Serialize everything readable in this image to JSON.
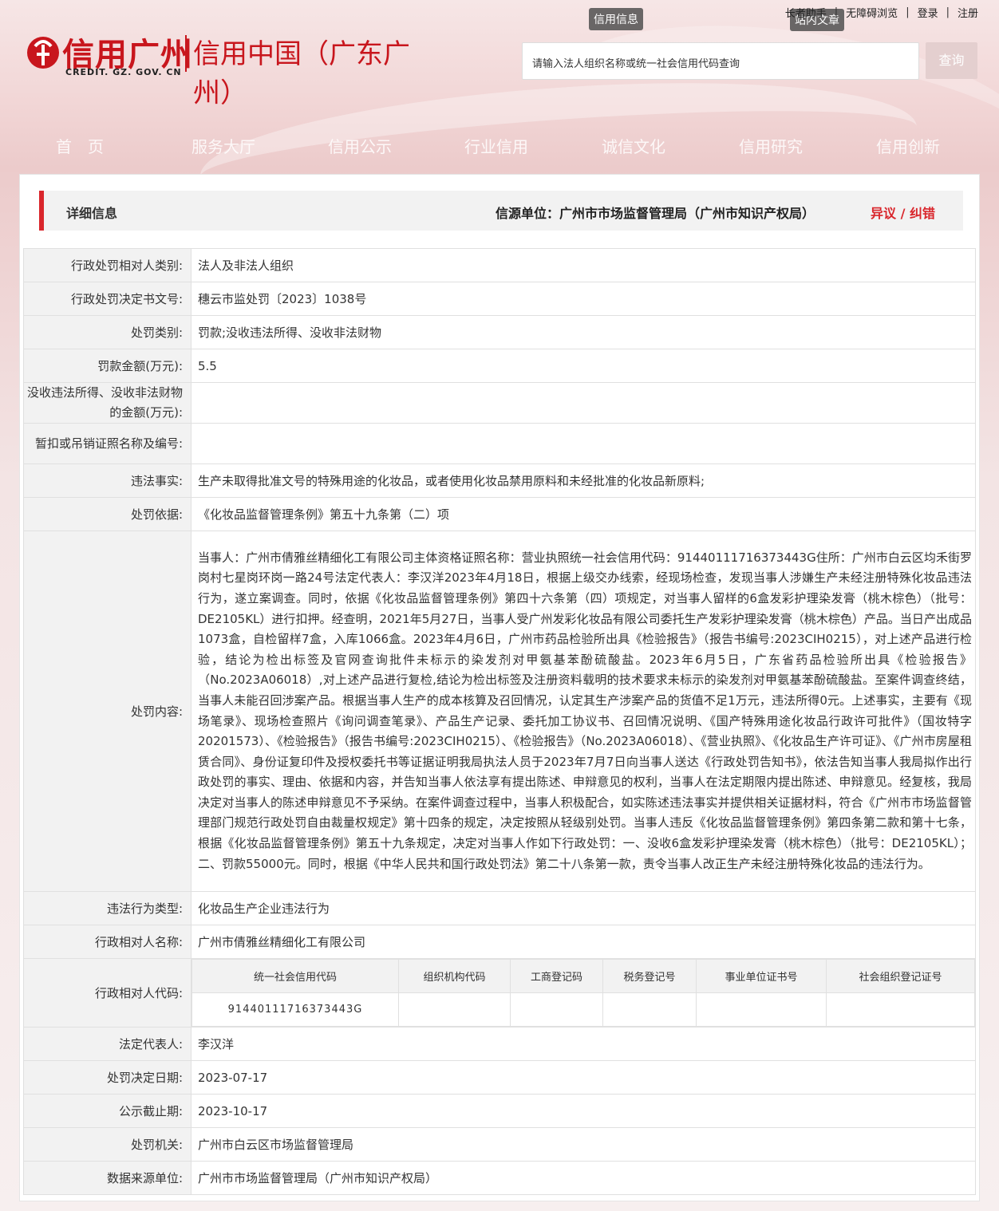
{
  "header": {
    "logo_cn": "信用广州",
    "logo_en": "CREDIT. GZ. GOV. CN",
    "site_title": "信用中国（广东广州）",
    "tag_credit": "信用信息",
    "tag_site": "站内文章",
    "toplinks": [
      "长者助手",
      "无障碍浏览",
      "登录",
      "注册"
    ],
    "search_placeholder": "请输入法人组织名称或统一社会信用代码查询",
    "search_button": "查询"
  },
  "nav": [
    "首　页",
    "服务大厅",
    "信用公示",
    "行业信用",
    "诚信文化",
    "信用研究",
    "信用创新"
  ],
  "titlebar": {
    "title": "详细信息",
    "source": "信源单位：广州市市场监督管理局（广州市知识产权局）",
    "objection": "异议 / 纠错"
  },
  "rows": [
    {
      "label": "行政处罚相对人类别:",
      "value": "法人及非法人组织"
    },
    {
      "label": "行政处罚决定书文号:",
      "value": "穗云市监处罚〔2023〕1038号"
    },
    {
      "label": "处罚类别:",
      "value": "罚款;没收违法所得、没收非法财物"
    },
    {
      "label": "罚款金额(万元):",
      "value": "5.5"
    },
    {
      "label": "没收违法所得、没收非法财物的金额(万元):",
      "value": ""
    },
    {
      "label": "暂扣或吊销证照名称及编号:",
      "value": ""
    },
    {
      "label": "违法事实:",
      "value": "生产未取得批准文号的特殊用途的化妆品，或者使用化妆品禁用原料和未经批准的化妆品新原料;"
    },
    {
      "label": "处罚依据:",
      "value": "《化妆品监督管理条例》第五十九条第（二）项"
    },
    {
      "label": "处罚内容:",
      "value": "当事人：广州市倩雅丝精细化工有限公司主体资格证照名称：营业执照统一社会信用代码：91440111716373443G住所：广州市白云区均禾街罗岗村七星岗环岗一路24号法定代表人：李汉洋2023年4月18日，根据上级交办线索，经现场检查，发现当事人涉嫌生产未经注册特殊化妆品违法行为，遂立案调查。同时，依据《化妆品监督管理条例》第四十六条第（四）项规定，对当事人留样的6盒发彩护理染发膏（桃木棕色）（批号：DE2105KL）进行扣押。经查明，2021年5月27日，当事人受广州发彩化妆品有限公司委托生产发彩护理染发膏（桃木棕色）产品。当日产出成品1073盒，自检留样7盒，入库1066盒。2023年4月6日，广州市药品检验所出具《检验报告》（报告书编号:2023CIH0215），对上述产品进行检验，结论为检出标签及官网查询批件未标示的染发剂对甲氨基苯酚硫酸盐。2023年6月5日，广东省药品检验所出具《检验报告》（No.2023A06018）,对上述产品进行复检,结论为检出标签及注册资料载明的技术要求未标示的染发剂对甲氨基苯酚硫酸盐。至案件调查终结，当事人未能召回涉案产品。根据当事人生产的成本核算及召回情况，认定其生产涉案产品的货值不足1万元，违法所得0元。上述事实，主要有《现场笔录》、现场检查照片《询问调查笔录》、产品生产记录、委托加工协议书、召回情况说明、《国产特殊用途化妆品行政许可批件》（国妆特字20201573）、《检验报告》（报告书编号:2023CIH0215）、《检验报告》（No.2023A06018）、《营业执照》、《化妆品生产许可证》、《广州市房屋租赁合同》、身份证复印件及授权委托书等证据证明我局执法人员于2023年7月7日向当事人送达《行政处罚告知书》，依法告知当事人我局拟作出行政处罚的事实、理由、依据和内容，并告知当事人依法享有提出陈述、申辩意见的权利，当事人在法定期限内提出陈述、申辩意见。经复核，我局决定对当事人的陈述申辩意见不予采纳。在案件调查过程中，当事人积极配合，如实陈述违法事实并提供相关证据材料，符合《广州市市场监督管理部门规范行政处罚自由裁量权规定》第十四条的规定，决定按照从轻级别处罚。当事人违反《化妆品监督管理条例》第四条第二款和第十七条，根据《化妆品监督管理条例》第五十九条规定，决定对当事人作如下行政处罚：一、没收6盒发彩护理染发膏（桃木棕色）（批号：DE2105KL）；二、罚款55000元。同时，根据《中华人民共和国行政处罚法》第二十八条第一款，责令当事人改正生产未经注册特殊化妆品的违法行为。"
    },
    {
      "label": "违法行为类型:",
      "value": "化妆品生产企业违法行为"
    },
    {
      "label": "行政相对人名称:",
      "value": "广州市倩雅丝精细化工有限公司"
    }
  ],
  "codes": {
    "label": "行政相对人代码:",
    "headers": [
      "统一社会信用代码",
      "组织机构代码",
      "工商登记码",
      "税务登记号",
      "事业单位证书号",
      "社会组织登记证号"
    ],
    "values": [
      "91440111716373443G",
      "",
      "",
      "",
      "",
      ""
    ]
  },
  "rows2": [
    {
      "label": "法定代表人:",
      "value": "李汉洋"
    },
    {
      "label": "处罚决定日期:",
      "value": "2023-07-17"
    },
    {
      "label": "公示截止期:",
      "value": "2023-10-17"
    },
    {
      "label": "处罚机关:",
      "value": "广州市白云区市场监督管理局"
    },
    {
      "label": "数据来源单位:",
      "value": "广州市市场监督管理局（广州市知识产权局）"
    }
  ],
  "colors": {
    "brand_red": "#c8161d",
    "accent_red": "#d9262c"
  }
}
